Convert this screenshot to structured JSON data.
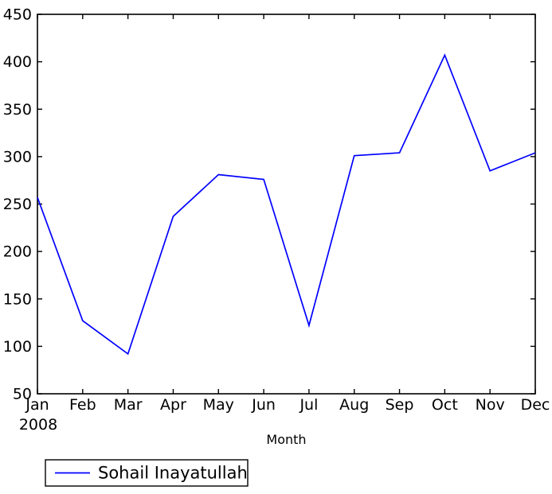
{
  "chart_data": {
    "type": "line",
    "title": "",
    "xlabel": "Month",
    "ylabel": "",
    "categories": [
      "Jan",
      "Feb",
      "Mar",
      "Apr",
      "May",
      "Jun",
      "Jul",
      "Aug",
      "Sep",
      "Oct",
      "Nov",
      "Dec"
    ],
    "x_sublabel": "2008",
    "xtick_labels": [
      "Jan",
      "Feb",
      "Mar",
      "Apr",
      "May",
      "Jun",
      "Jul",
      "Aug",
      "Sep",
      "Oct",
      "Nov",
      "Dec"
    ],
    "ytick_labels": [
      "50",
      "100",
      "150",
      "200",
      "250",
      "300",
      "350",
      "400",
      "450"
    ],
    "ytick_values": [
      50,
      100,
      150,
      200,
      250,
      300,
      350,
      400,
      450
    ],
    "ylim": [
      50,
      450
    ],
    "xlim": [
      0,
      11
    ],
    "grid": false,
    "legend_position": "below-left",
    "series": [
      {
        "name": "Sohail Inayatullah",
        "color": "#0000ff",
        "values": [
          257,
          127,
          92,
          237,
          281,
          276,
          122,
          301,
          304,
          407,
          285,
          304
        ]
      }
    ]
  },
  "legend": {
    "entries": [
      {
        "label": "Sohail Inayatullah",
        "color": "#0000ff"
      }
    ]
  },
  "axes": {
    "x_axis_label": "Month",
    "x_year_label": "2008"
  }
}
